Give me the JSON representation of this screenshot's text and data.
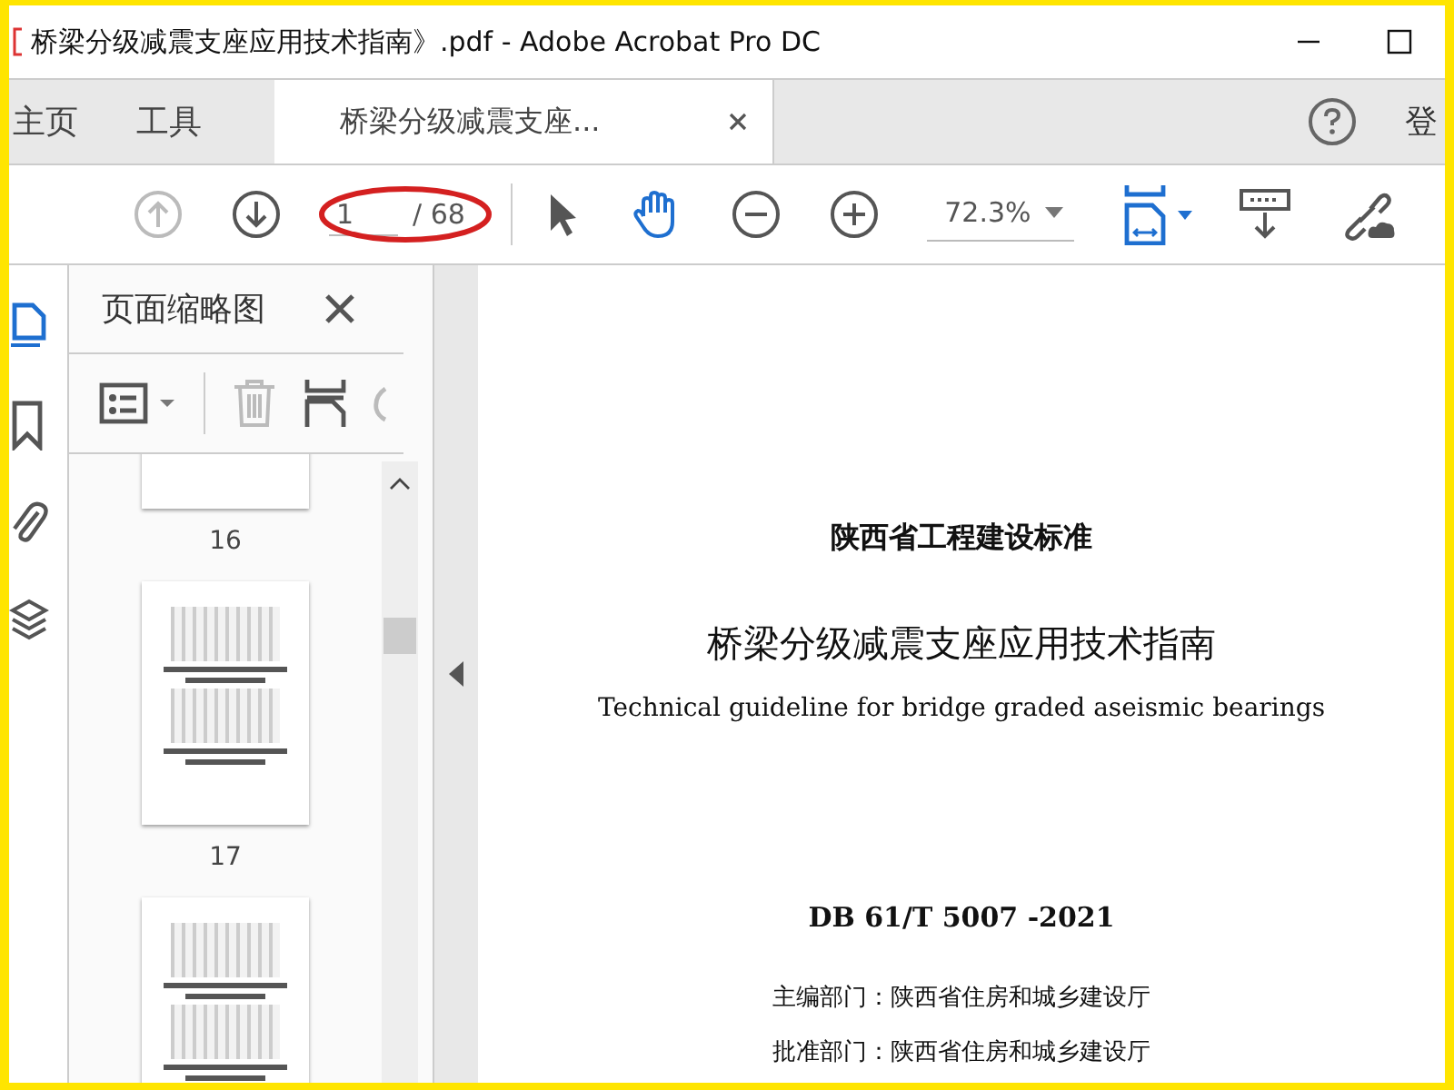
{
  "window": {
    "title": "桥梁分级减震支座应用技术指南》.pdf - Adobe Acrobat Pro DC"
  },
  "tabs": [
    {
      "label": "主页",
      "selected": false,
      "closable": false
    },
    {
      "label": "工具",
      "selected": false,
      "closable": false
    },
    {
      "label": "桥梁分级减震支座...",
      "selected": true,
      "closable": true
    }
  ],
  "account": {
    "label": "登"
  },
  "toolbar": {
    "page_value": "1",
    "page_total": "/ 68",
    "zoom": "72.3%"
  },
  "rail": [
    {
      "kind": "pages",
      "selected": true
    },
    {
      "kind": "bookmarks",
      "selected": false
    },
    {
      "kind": "attachments",
      "selected": false
    },
    {
      "kind": "layers",
      "selected": false
    }
  ],
  "panel": {
    "title": "页面缩略图",
    "thumbnails": [
      {
        "label": "16",
        "selected": false
      },
      {
        "label": "17",
        "selected": false
      },
      {
        "selected": false
      }
    ]
  },
  "document": {
    "lines": [
      {
        "kind": "heading",
        "text": "陕西省工程建设标准"
      },
      {
        "kind": "title",
        "text": "桥梁分级减震支座应用技术指南"
      },
      {
        "kind": "subtitle",
        "text": "Technical guideline for bridge graded aseismic bearings"
      },
      {
        "kind": "code",
        "text": "DB 61/T 5007 -2021"
      },
      {
        "kind": "meta",
        "text": "主编部门：陕西省住房和城乡建设厅"
      },
      {
        "kind": "meta",
        "text": "批准部门：陕西省住房和城乡建设厅"
      }
    ]
  }
}
